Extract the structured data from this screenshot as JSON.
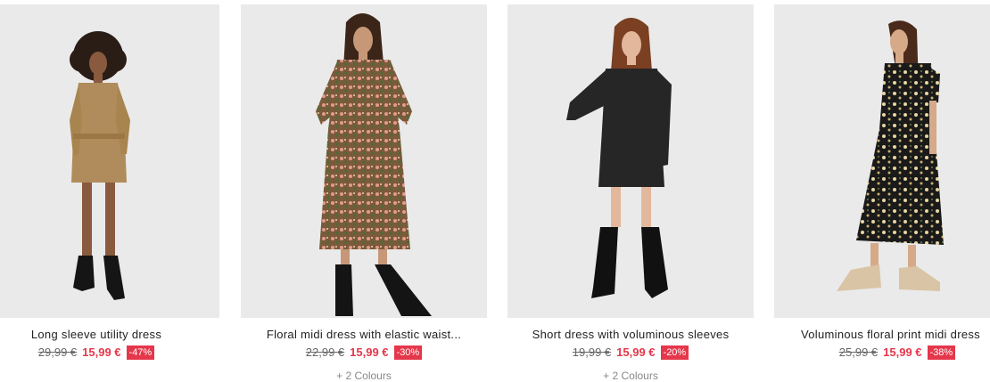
{
  "products": [
    {
      "name": "Long sleeve utility dress",
      "old_price": "29,99 €",
      "new_price": "15,99 €",
      "discount": "-47%",
      "colours": "",
      "image": "woman-khaki-utility-dress-photo"
    },
    {
      "name": "Floral midi dress with elastic waist...",
      "old_price": "22,99 €",
      "new_price": "15,99 €",
      "discount": "-30%",
      "colours": "+ 2 Colours",
      "image": "woman-floral-midi-dress-photo"
    },
    {
      "name": "Short dress with voluminous sleeves",
      "old_price": "19,99 €",
      "new_price": "15,99 €",
      "discount": "-20%",
      "colours": "+ 2 Colours",
      "image": "woman-black-short-dress-photo"
    },
    {
      "name": "Voluminous floral print midi dress",
      "old_price": "25,99 €",
      "new_price": "15,99 €",
      "discount": "-38%",
      "colours": "",
      "image": "woman-black-floral-midi-dress-photo"
    }
  ],
  "colors": {
    "sale_red": "#e5374b",
    "photo_bg": "#eaeaea",
    "text": "#222222",
    "muted": "#888888"
  }
}
